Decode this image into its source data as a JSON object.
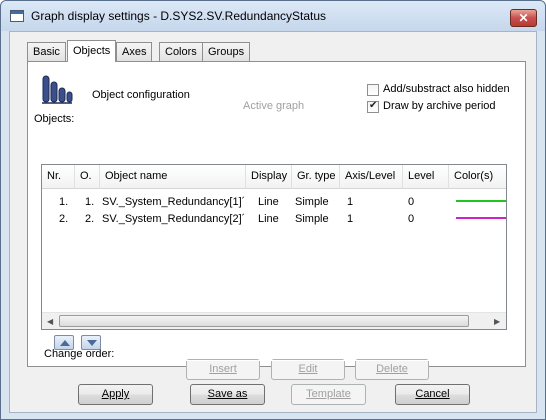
{
  "window": {
    "title": "Graph display settings - D.SYS2.SV.RedundancyStatus",
    "close_label": "✕"
  },
  "tabs": [
    {
      "label": "Basic",
      "active": false
    },
    {
      "label": "Objects",
      "active": true
    },
    {
      "label": "Axes",
      "active": false
    },
    {
      "label": "Colors",
      "active": false
    },
    {
      "label": "Groups",
      "active": false
    }
  ],
  "objects_tab": {
    "section_title": "Object configuration",
    "active_graph_label": "Active graph",
    "add_hidden_label": "Add/substract also hidden",
    "add_hidden_checked": false,
    "archive_period_label": "Draw by archive period",
    "archive_period_checked": true,
    "objects_label": "Objects:",
    "columns": [
      "Nr.",
      "O.",
      "Object name",
      "Display",
      "Gr. type",
      "Axis/Level",
      "Level",
      "Color(s)"
    ],
    "rows": [
      {
        "nr": "1.",
        "o": "1.",
        "name": "SV._System_Redundancy[1]´",
        "display": "Line",
        "gr_type": "Simple",
        "axis_level": "1",
        "level": "0",
        "color": "#22c422"
      },
      {
        "nr": "2.",
        "o": "2.",
        "name": "SV._System_Redundancy[2]´",
        "display": "Line",
        "gr_type": "Simple",
        "axis_level": "1",
        "level": "0",
        "color": "#cc22cc"
      }
    ],
    "change_order_label": "Change order:",
    "insert_label": "Insert",
    "edit_label": "Edit",
    "delete_label": "Delete"
  },
  "footer": {
    "apply_label": "Apply",
    "save_as_label": "Save as",
    "template_label": "Template",
    "cancel_label": "Cancel"
  }
}
